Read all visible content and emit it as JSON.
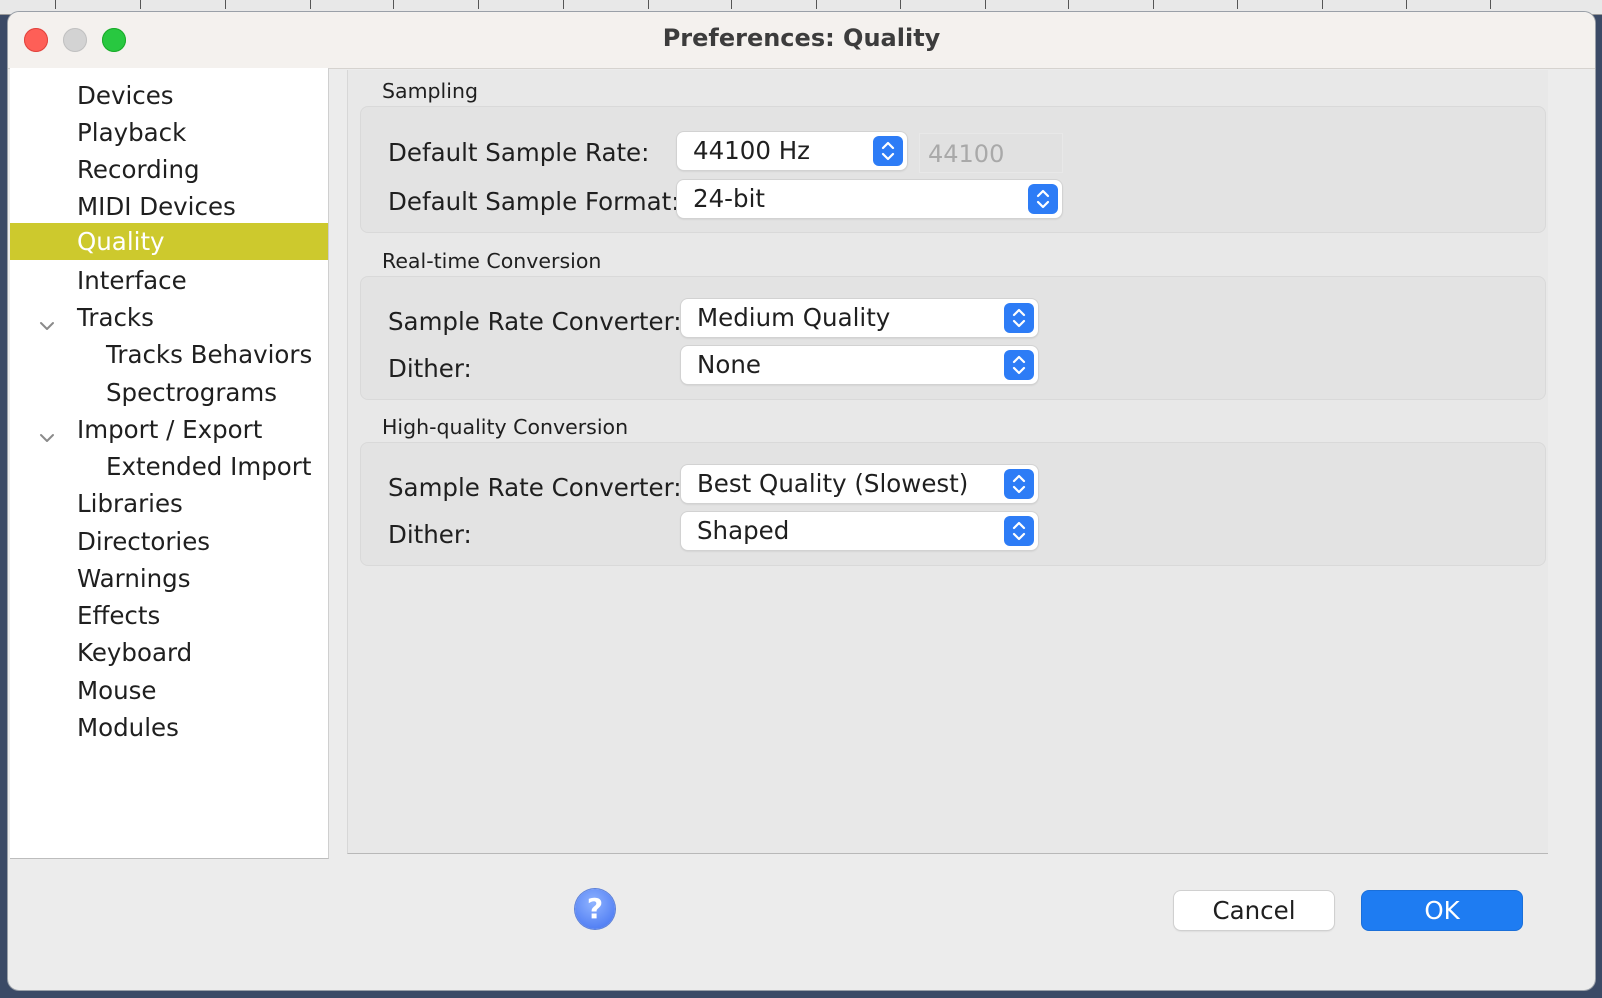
{
  "window": {
    "title": "Preferences: Quality"
  },
  "sidebar": {
    "items": [
      {
        "label": "Devices"
      },
      {
        "label": "Playback"
      },
      {
        "label": "Recording"
      },
      {
        "label": "MIDI Devices"
      },
      {
        "label": "Quality",
        "selected": true
      },
      {
        "label": "Interface"
      },
      {
        "label": "Tracks",
        "expanded": true
      },
      {
        "label": "Tracks Behaviors"
      },
      {
        "label": "Spectrograms"
      },
      {
        "label": "Import / Export",
        "expanded": true
      },
      {
        "label": "Extended Import"
      },
      {
        "label": "Libraries"
      },
      {
        "label": "Directories"
      },
      {
        "label": "Warnings"
      },
      {
        "label": "Effects"
      },
      {
        "label": "Keyboard"
      },
      {
        "label": "Mouse"
      },
      {
        "label": "Modules"
      }
    ],
    "selected_color": "#cdc92d"
  },
  "sampling": {
    "title": "Sampling",
    "rate_label": "Default Sample Rate:",
    "rate_value": "44100 Hz",
    "rate_field_placeholder": "44100",
    "format_label": "Default Sample Format:",
    "format_value": "24-bit"
  },
  "realtime": {
    "title": "Real-time Conversion",
    "converter_label": "Sample Rate Converter:",
    "converter_value": "Medium Quality",
    "dither_label": "Dither:",
    "dither_value": "None"
  },
  "highquality": {
    "title": "High-quality Conversion",
    "converter_label": "Sample Rate Converter:",
    "converter_value": "Best Quality (Slowest)",
    "dither_label": "Dither:",
    "dither_value": "Shaped"
  },
  "footer": {
    "help_glyph": "?",
    "cancel_label": "Cancel",
    "ok_label": "OK"
  },
  "colors": {
    "accent": "#1e7cf2",
    "stepper": "#2d7cf6"
  }
}
